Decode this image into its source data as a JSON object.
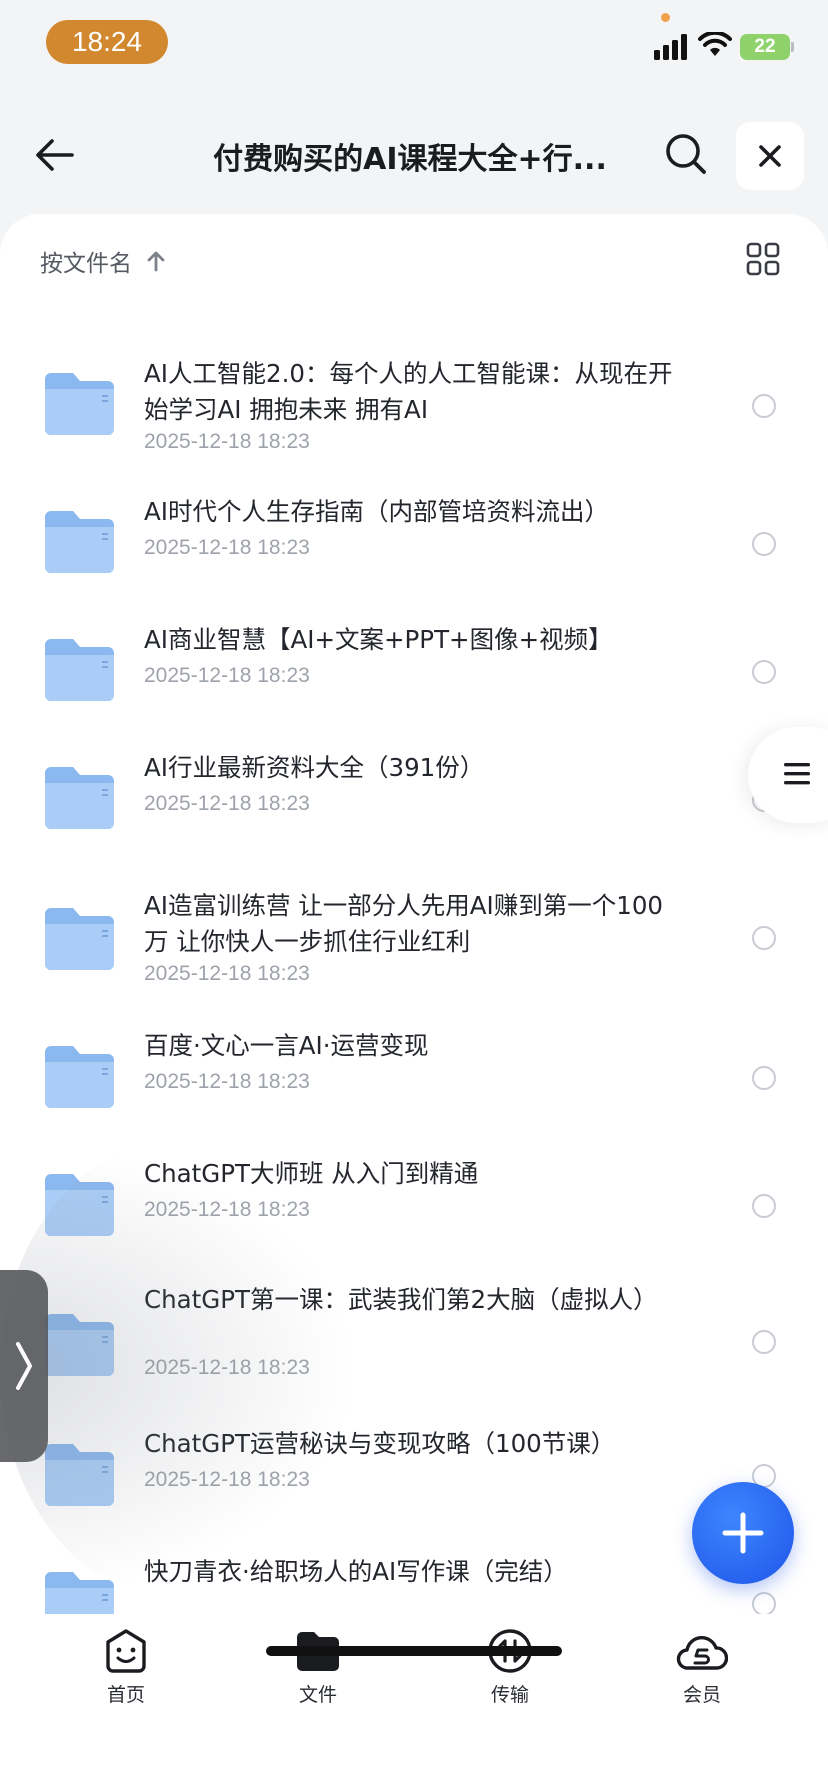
{
  "status_bar": {
    "time": "18:24",
    "battery": "22"
  },
  "header": {
    "title": "付费购买的AI课程大全+行..."
  },
  "sort": {
    "label": "按文件名",
    "direction_icon": "arrow-up-icon"
  },
  "files": [
    {
      "name": "AI人工智能2.0：每个人的人工智能课：从现在开始学习AI 拥抱未来 拥有AI",
      "date": "2025-12-18 18:23"
    },
    {
      "name": "AI时代个人生存指南（内部管培资料流出）",
      "date": "2025-12-18 18:23"
    },
    {
      "name": "AI商业智慧【AI+文案+PPT+图像+视频】",
      "date": "2025-12-18 18:23"
    },
    {
      "name": "AI行业最新资料大全（391份）",
      "date": "2025-12-18 18:23"
    },
    {
      "name": "AI造富训练营 让一部分人先用AI赚到第一个100万 让你快人一步抓住行业红利",
      "date": "2025-12-18 18:23"
    },
    {
      "name": "百度·文心一言AI·运营变现",
      "date": "2025-12-18 18:23"
    },
    {
      "name": "ChatGPT大师班 从入门到精通",
      "date": "2025-12-18 18:23"
    },
    {
      "name": "ChatGPT第一课：武装我们第2大脑（虚拟人）",
      "date": "2025-12-18 18:23"
    },
    {
      "name": "ChatGPT运营秘诀与变现攻略（100节课）",
      "date": "2025-12-18 18:23"
    },
    {
      "name": "快刀青衣·给职场人的AI写作课（完结）",
      "date": ""
    }
  ],
  "tabs": [
    {
      "label": "首页",
      "icon": "home-smile-icon"
    },
    {
      "label": "文件",
      "icon": "folder-icon"
    },
    {
      "label": "传输",
      "icon": "transfer-icon"
    },
    {
      "label": "会员",
      "icon": "cloud-vip-icon"
    }
  ],
  "colors": {
    "accent": "#2a66f0",
    "time_pill": "#d2882e",
    "battery": "#8fd16b"
  }
}
